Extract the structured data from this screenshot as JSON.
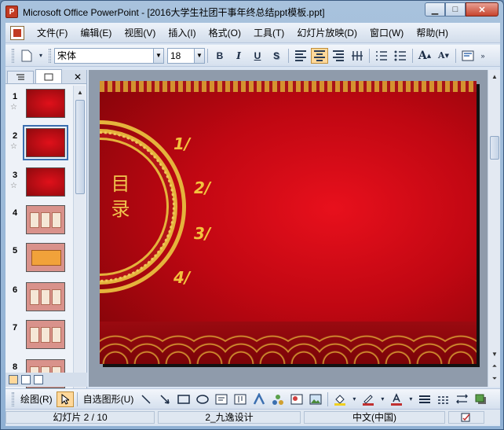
{
  "window": {
    "title": "Microsoft Office PowerPoint - [2016大学生社团干事年终总结ppt模板.ppt]",
    "minimize_icon": "minimize-icon",
    "maximize_icon": "maximize-icon",
    "close_icon": "close-icon"
  },
  "menu": {
    "items": [
      "文件(F)",
      "编辑(E)",
      "视图(V)",
      "插入(I)",
      "格式(O)",
      "工具(T)",
      "幻灯片放映(D)",
      "窗口(W)",
      "帮助(H)"
    ]
  },
  "toolbar": {
    "font_name": "宋体",
    "font_size": "18",
    "bold": "B",
    "italic": "I",
    "underline": "U",
    "shadow": "S",
    "grow_font": "A",
    "shrink_font": "A",
    "active_alignment": "center"
  },
  "side": {
    "slides": [
      {
        "num": "1",
        "star": "☆",
        "style": "red"
      },
      {
        "num": "2",
        "star": "☆",
        "style": "red",
        "selected": true
      },
      {
        "num": "3",
        "star": "☆",
        "style": "red"
      },
      {
        "num": "4",
        "star": "",
        "style": "pink"
      },
      {
        "num": "5",
        "star": "",
        "style": "orange"
      },
      {
        "num": "6",
        "star": "",
        "style": "pink"
      },
      {
        "num": "7",
        "star": "",
        "style": "pink"
      },
      {
        "num": "8",
        "star": "",
        "style": "pink"
      }
    ]
  },
  "slide": {
    "title": "目录",
    "items": [
      "1/",
      "2/",
      "3/",
      "4/"
    ],
    "colors": {
      "background": "#c00712",
      "gold": "#f3c23e"
    }
  },
  "drawbar": {
    "draw": "绘图(R)",
    "autoshapes": "自选图形(U)"
  },
  "status": {
    "slide": "幻灯片 2 / 10",
    "design": "2_九逸设计",
    "language": "中文(中国)"
  }
}
